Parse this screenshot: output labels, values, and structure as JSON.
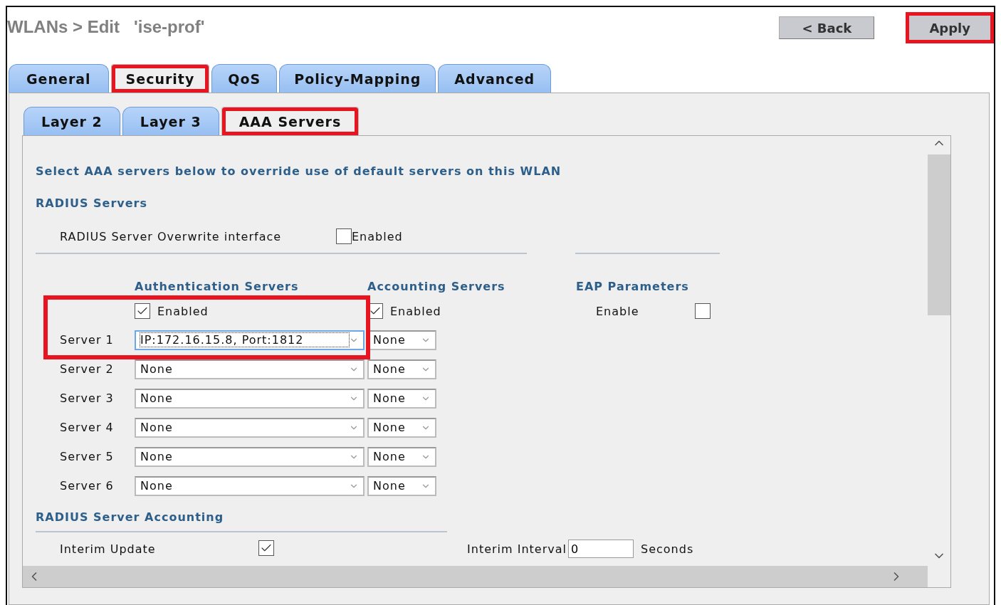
{
  "header": {
    "breadcrumb": "WLANs > Edit",
    "wlan_name": "'ise-prof'"
  },
  "buttons": [
    {
      "label": "< Back",
      "highlighted": false
    },
    {
      "label": "Apply",
      "highlighted": true
    }
  ],
  "tabs": [
    {
      "label": "General",
      "selected": false,
      "highlighted": false
    },
    {
      "label": "Security",
      "selected": true,
      "highlighted": true
    },
    {
      "label": "QoS",
      "selected": false,
      "highlighted": false
    },
    {
      "label": "Policy-Mapping",
      "selected": false,
      "highlighted": false
    },
    {
      "label": "Advanced",
      "selected": false,
      "highlighted": false
    }
  ],
  "subtabs": [
    {
      "label": "Layer 2",
      "selected": false,
      "highlighted": false
    },
    {
      "label": "Layer 3",
      "selected": false,
      "highlighted": false
    },
    {
      "label": "AAA Servers",
      "selected": true,
      "highlighted": true
    }
  ],
  "intro": "Select AAA servers below to override use of default servers on this WLAN",
  "radius_servers": {
    "title": "RADIUS Servers",
    "overwrite_label": "RADIUS Server Overwrite interface",
    "overwrite_checkbox": {
      "label": "Enabled",
      "checked": false
    }
  },
  "auth_column": {
    "title": "Authentication Servers",
    "enabled_label": "Enabled",
    "checked": true
  },
  "acct_column": {
    "title": "Accounting Servers",
    "enabled_label": "Enabled",
    "checked": true
  },
  "eap": {
    "title": "EAP Parameters",
    "label": "Enable",
    "checked": false
  },
  "auth_highlighted": true,
  "servers": [
    {
      "label": "Server 1",
      "auth": "IP:172.16.15.8, Port:1812",
      "acct": "None",
      "focused": true
    },
    {
      "label": "Server 2",
      "auth": "None",
      "acct": "None",
      "focused": false
    },
    {
      "label": "Server 3",
      "auth": "None",
      "acct": "None",
      "focused": false
    },
    {
      "label": "Server 4",
      "auth": "None",
      "acct": "None",
      "focused": false
    },
    {
      "label": "Server 5",
      "auth": "None",
      "acct": "None",
      "focused": false
    },
    {
      "label": "Server 6",
      "auth": "None",
      "acct": "None",
      "focused": false
    }
  ],
  "accounting": {
    "title": "RADIUS Server Accounting",
    "interim_update_label": "Interim Update",
    "interim_update": true,
    "interval_label": "Interim Interval",
    "interval": "0",
    "unit": "Seconds"
  }
}
